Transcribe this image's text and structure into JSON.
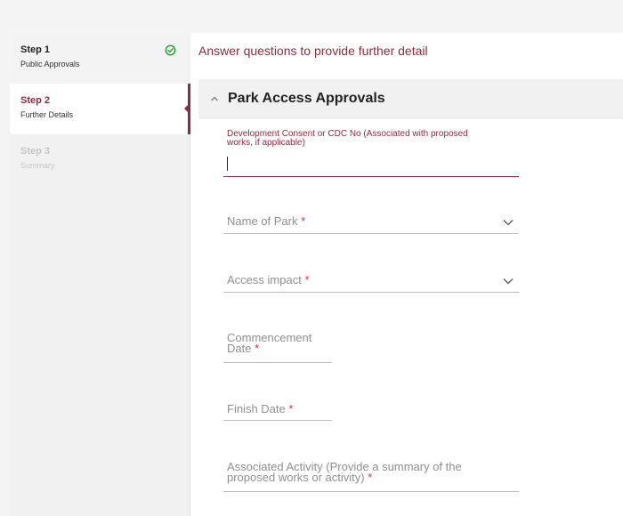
{
  "sidebar": {
    "steps": [
      {
        "title": "Step 1",
        "subtitle": "Public Approvals",
        "status": "complete"
      },
      {
        "title": "Step 2",
        "subtitle": "Further Details",
        "status": "active"
      },
      {
        "title": "Step 3",
        "subtitle": "Summary",
        "status": "disabled"
      }
    ]
  },
  "main": {
    "heading": "Answer questions to provide further detail",
    "section": {
      "title": "Park Access Approvals",
      "expanded": true
    },
    "fields": {
      "consent": {
        "label": "Development Consent or CDC No (Associated with proposed works, if applicable)",
        "value": ""
      },
      "park": {
        "label": "Name of Park",
        "required_mark": "*"
      },
      "access": {
        "label": "Access impact",
        "required_mark": "*"
      },
      "commencement": {
        "label": "Commencement Date",
        "required_mark": "*"
      },
      "finish": {
        "label": "Finish Date",
        "required_mark": "*"
      },
      "activity": {
        "label": "Associated Activity (Provide a summary of the proposed works or activity)",
        "required_mark": "*"
      }
    }
  },
  "colors": {
    "accent": "#8a2c3f",
    "success": "#2e9e3f",
    "required": "#d6344a",
    "muted": "#8f8f8f"
  },
  "icons": {
    "step1_status": "check-circle-icon",
    "section_toggle": "chevron-up-icon",
    "select_toggle": "chevron-down-icon"
  }
}
